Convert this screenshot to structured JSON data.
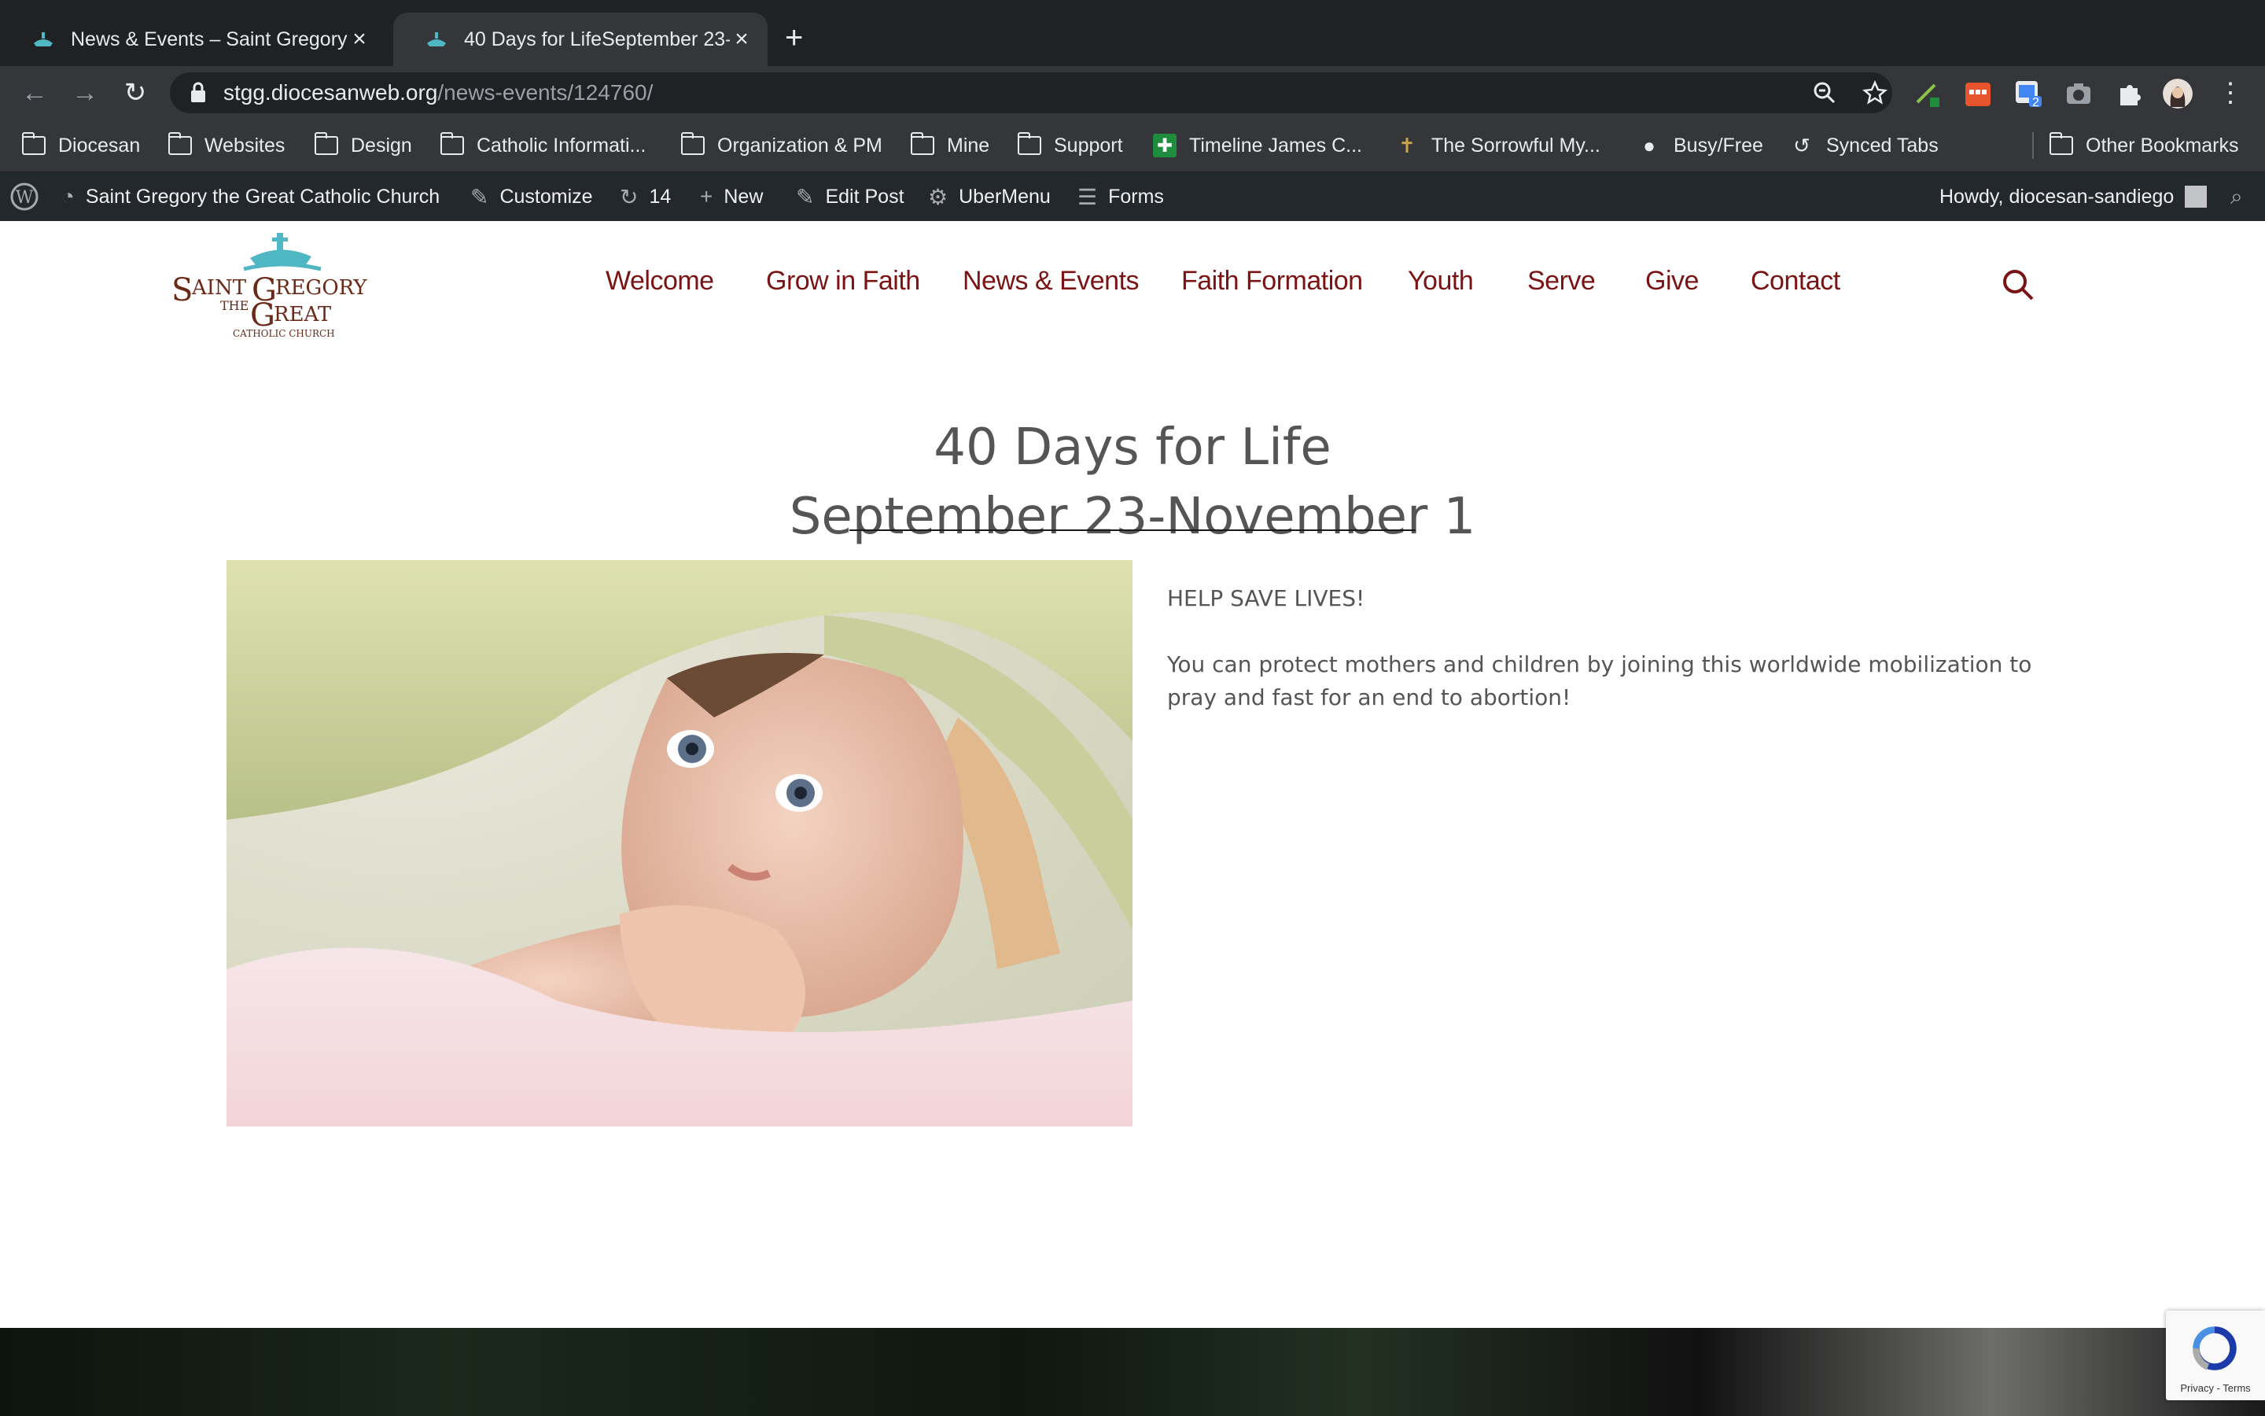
{
  "browser": {
    "tabs": [
      {
        "title": "News & Events – Saint Gregory",
        "active": false
      },
      {
        "title": "40 Days for LifeSeptember 23-",
        "active": true
      }
    ],
    "url_domain": "stgg.diocesanweb.org",
    "url_path": "/news-events/124760/",
    "extension_badge": "2"
  },
  "bookmarks": {
    "items": [
      {
        "label": "Diocesan",
        "icon": "folder-icon"
      },
      {
        "label": "Websites",
        "icon": "folder-icon"
      },
      {
        "label": "Design",
        "icon": "folder-icon"
      },
      {
        "label": "Catholic Informati...",
        "icon": "folder-icon"
      },
      {
        "label": "Organization & PM",
        "icon": "folder-icon"
      },
      {
        "label": "Mine",
        "icon": "folder-icon"
      },
      {
        "label": "Support",
        "icon": "folder-icon"
      },
      {
        "label": "Timeline James C...",
        "icon": "green-cross-icon"
      },
      {
        "label": "The Sorrowful My...",
        "icon": "rosary-icon"
      },
      {
        "label": "Busy/Free",
        "icon": "globe-icon"
      },
      {
        "label": "Synced Tabs",
        "icon": "history-icon"
      }
    ],
    "other": "Other Bookmarks"
  },
  "adminbar": {
    "site_name": "Saint Gregory the Great Catholic Church",
    "customize": "Customize",
    "updates": "14",
    "new": "New",
    "edit_post": "Edit Post",
    "ubermenu": "UberMenu",
    "forms": "Forms",
    "howdy": "Howdy, diocesan-sandiego"
  },
  "site": {
    "nav": [
      "Welcome",
      "Grow in Faith",
      "News & Events",
      "Faith Formation",
      "Youth",
      "Serve",
      "Give",
      "Contact"
    ],
    "nav_color": "#7a1414"
  },
  "post": {
    "title_line1": "40 Days for Life",
    "title_line2": "September 23-November 1",
    "paragraph1": "HELP SAVE LIVES!",
    "paragraph2": "You can protect mothers and children by joining this worldwide mobilization to pray and fast for an end to abortion!"
  },
  "recaptcha": {
    "links": "Privacy - Terms"
  }
}
